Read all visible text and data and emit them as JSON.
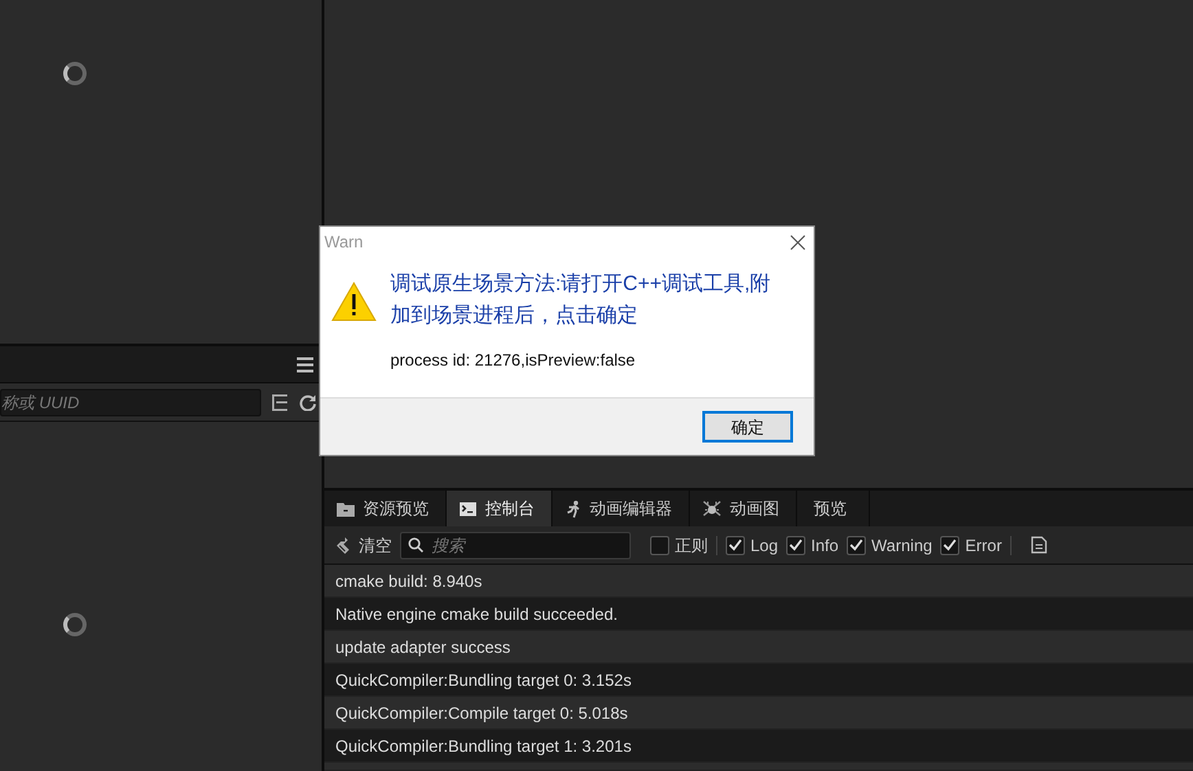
{
  "left_panel": {
    "search": {
      "placeholder": "称或 UUID"
    }
  },
  "console": {
    "tabs": [
      {
        "label": "资源预览",
        "kind": "folder",
        "selected": false
      },
      {
        "label": "控制台",
        "kind": "terminal",
        "selected": true
      },
      {
        "label": "动画编辑器",
        "kind": "animation",
        "selected": false
      },
      {
        "label": "动画图",
        "kind": "graph",
        "selected": false
      },
      {
        "label": "预览",
        "kind": "plain",
        "selected": false
      }
    ],
    "toolbar": {
      "clear_label": "清空",
      "search": {
        "placeholder": "搜索"
      },
      "filters": [
        {
          "label": "正则",
          "checked": false
        },
        {
          "label": "Log",
          "checked": true
        },
        {
          "label": "Info",
          "checked": true
        },
        {
          "label": "Warning",
          "checked": true
        },
        {
          "label": "Error",
          "checked": true
        }
      ]
    },
    "rows": [
      {
        "text": "cmake build: 8.940s"
      },
      {
        "text": "Native engine cmake build succeeded."
      },
      {
        "text": "update adapter success"
      },
      {
        "text": "QuickCompiler:Bundling target 0: 3.152s"
      },
      {
        "text": "QuickCompiler:Compile target 0: 5.018s"
      },
      {
        "text": "QuickCompiler:Bundling target 1: 3.201s"
      }
    ]
  },
  "dialog": {
    "title": "Warn",
    "message": "调试原生场景方法:请打开C++调试工具,附加到场景进程后，点击确定",
    "detail": "process id: 21276,isPreview:false",
    "button": "确定"
  }
}
